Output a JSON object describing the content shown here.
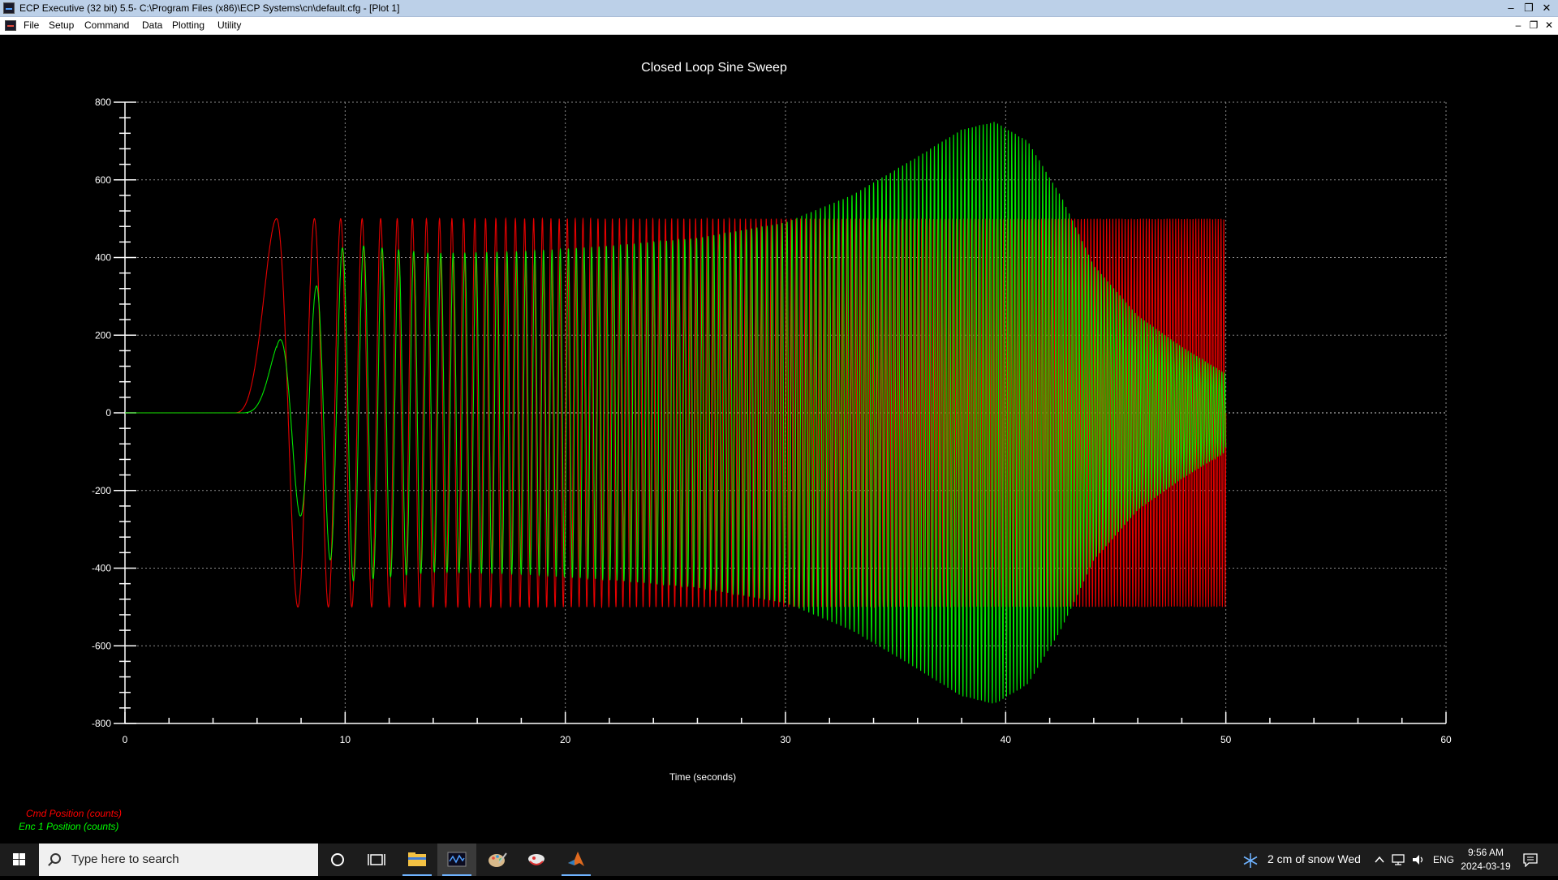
{
  "window": {
    "title": "ECP Executive (32 bit) 5.5- C:\\Program Files (x86)\\ECP Systems\\cn\\default.cfg - [Plot 1]",
    "controls": [
      "–",
      "❐",
      "✕"
    ]
  },
  "menu": {
    "items": [
      "File",
      "Setup",
      "Command",
      "Data",
      "Plotting",
      "Utility"
    ],
    "mdi_controls": [
      "–",
      "❐",
      "✕"
    ]
  },
  "chart_data": {
    "type": "line",
    "title": "Closed Loop Sine Sweep",
    "xlabel": "Time (seconds)",
    "ylabel": "",
    "xlim": [
      0,
      60
    ],
    "ylim": [
      -800,
      800
    ],
    "x_major_ticks": [
      0,
      10,
      20,
      30,
      40,
      50,
      60
    ],
    "x_tick_labels": [
      "0",
      "10",
      "20",
      "30",
      "40",
      "50",
      "60"
    ],
    "y_major_ticks": [
      800,
      600,
      400,
      200,
      0,
      -200,
      -400,
      -600,
      -800
    ],
    "y_tick_labels": [
      "800",
      "600",
      "400",
      "200",
      "0",
      "-200",
      "-400",
      "-600",
      "-800"
    ],
    "grid": true,
    "background": "#000000",
    "sweep": {
      "start_time": 5,
      "end_time": 50,
      "start_freq_hz": 0.1,
      "end_freq_hz": 8
    },
    "series": [
      {
        "name": "Cmd Position (counts)",
        "color": "#ff0000",
        "amplitude": 500,
        "description_points": {
          "x": [
            10,
            13.8,
            16,
            17.9,
            19.3,
            50
          ],
          "y": [
            500,
            -500,
            500,
            -500,
            500,
            500
          ]
        }
      },
      {
        "name": "Enc 1 Position (counts)",
        "color": "#00ff00",
        "envelope": {
          "t": [
            5,
            10,
            14,
            18,
            22,
            26,
            30,
            33,
            36,
            38,
            39.5,
            41,
            42.5,
            44,
            46,
            48,
            50
          ],
          "amplitude": [
            20,
            435,
            410,
            415,
            430,
            450,
            490,
            560,
            660,
            730,
            750,
            700,
            560,
            380,
            250,
            170,
            100
          ]
        },
        "description_points": {
          "x": [
            10.3,
            13.9,
            16,
            17.9,
            39.5,
            50
          ],
          "y": [
            435,
            -410,
            435,
            -415,
            750,
            100
          ]
        }
      }
    ],
    "legend": [
      "Cmd Position (counts)",
      "Enc 1 Position (counts)"
    ]
  },
  "taskbar": {
    "search_placeholder": "Type here to search",
    "weather": "2 cm of snow Wed",
    "language": "ENG",
    "time": "9:56 AM",
    "date": "2024-03-19"
  }
}
